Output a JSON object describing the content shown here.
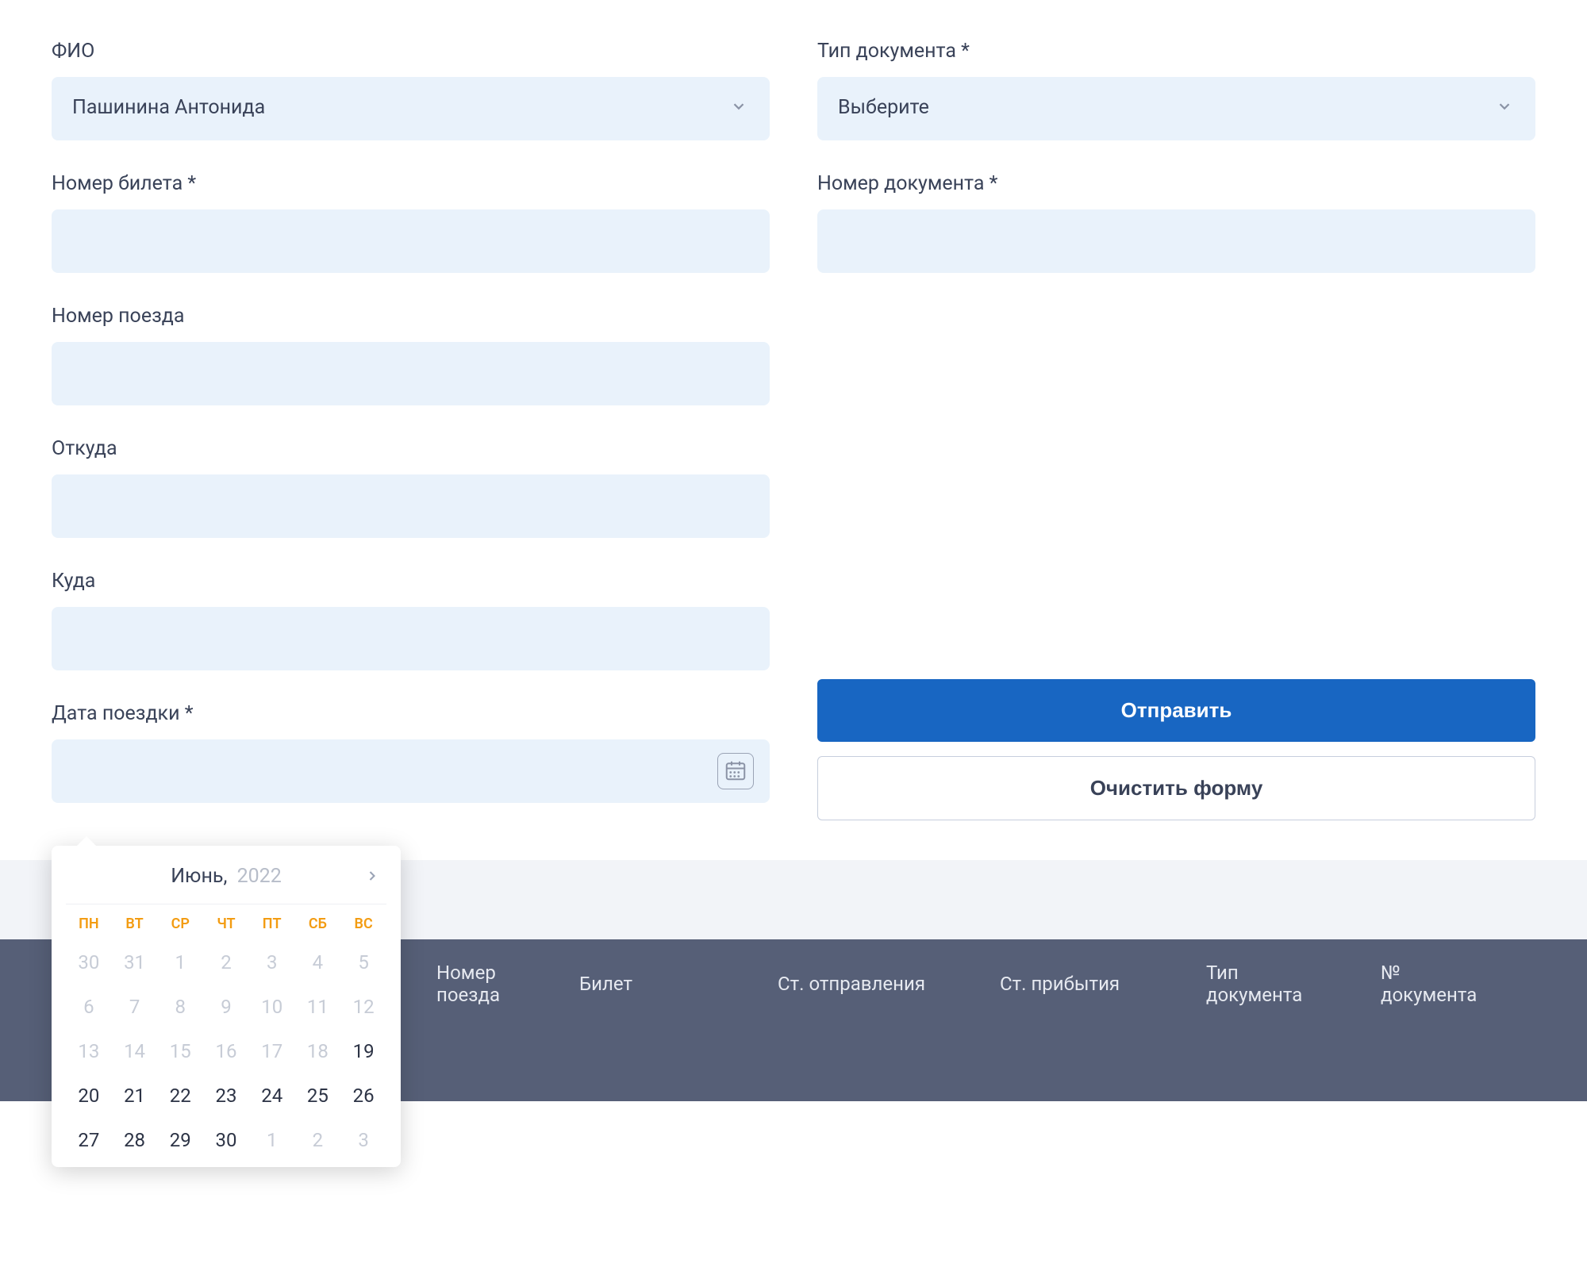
{
  "form": {
    "fio": {
      "label": "ФИО",
      "value": "Пашинина Антонида"
    },
    "doc_type": {
      "label": "Тип документа *",
      "value": "Выберите"
    },
    "ticket_number": {
      "label": "Номер билета *",
      "value": ""
    },
    "doc_number": {
      "label": "Номер документа *",
      "value": ""
    },
    "train_number": {
      "label": "Номер поезда",
      "value": ""
    },
    "from": {
      "label": "Откуда",
      "value": ""
    },
    "to": {
      "label": "Куда",
      "value": ""
    },
    "trip_date": {
      "label": "Дата поездки *",
      "value": ""
    }
  },
  "buttons": {
    "submit": "Отправить",
    "clear": "Очистить форму"
  },
  "calendar": {
    "month": "Июнь,",
    "year": "2022",
    "dow": [
      "ПН",
      "ВТ",
      "СР",
      "ЧТ",
      "ПТ",
      "СБ",
      "ВС"
    ],
    "days": [
      {
        "d": "30",
        "muted": true
      },
      {
        "d": "31",
        "muted": true
      },
      {
        "d": "1",
        "muted": true
      },
      {
        "d": "2",
        "muted": true
      },
      {
        "d": "3",
        "muted": true
      },
      {
        "d": "4",
        "muted": true
      },
      {
        "d": "5",
        "muted": true
      },
      {
        "d": "6",
        "muted": true
      },
      {
        "d": "7",
        "muted": true
      },
      {
        "d": "8",
        "muted": true
      },
      {
        "d": "9",
        "muted": true
      },
      {
        "d": "10",
        "muted": true
      },
      {
        "d": "11",
        "muted": true
      },
      {
        "d": "12",
        "muted": true
      },
      {
        "d": "13",
        "muted": true
      },
      {
        "d": "14",
        "muted": true
      },
      {
        "d": "15",
        "muted": true
      },
      {
        "d": "16",
        "muted": true
      },
      {
        "d": "17",
        "muted": true
      },
      {
        "d": "18",
        "muted": true
      },
      {
        "d": "19",
        "muted": false
      },
      {
        "d": "20",
        "muted": false
      },
      {
        "d": "21",
        "muted": false
      },
      {
        "d": "22",
        "muted": false
      },
      {
        "d": "23",
        "muted": false
      },
      {
        "d": "24",
        "muted": false
      },
      {
        "d": "25",
        "muted": false
      },
      {
        "d": "26",
        "muted": false
      },
      {
        "d": "27",
        "muted": false
      },
      {
        "d": "28",
        "muted": false
      },
      {
        "d": "29",
        "muted": false
      },
      {
        "d": "30",
        "muted": false
      },
      {
        "d": "1",
        "muted": true
      },
      {
        "d": "2",
        "muted": true
      },
      {
        "d": "3",
        "muted": true
      }
    ]
  },
  "table_headers": {
    "number_train": "Номер поезда",
    "ticket": "Билет",
    "dep_station": "Ст. отправления",
    "arr_station": "Ст. прибытия",
    "doc_type": "Тип документа",
    "doc_number": "№ документа"
  }
}
